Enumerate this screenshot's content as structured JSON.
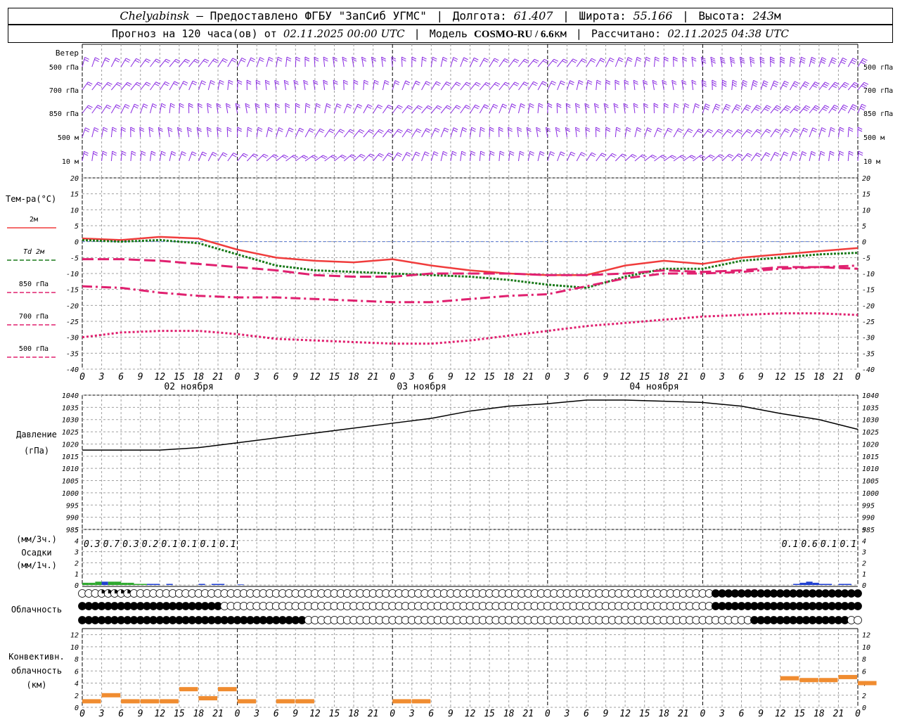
{
  "header": {
    "city": "Chelyabinsk",
    "dash": "–",
    "provider": "Предоставлено ФГБУ \"ЗапСиб УГМС\"",
    "lon_label": "Долгота:",
    "lon_value": "61.407",
    "lat_label": "Широта:",
    "lat_value": "55.166",
    "alt_label": "Высота:",
    "alt_value": "243",
    "alt_unit": "м",
    "forecast_label": "Прогноз на 120 часа(ов) от",
    "forecast_start": "02.11.2025 00:00 UTC",
    "model_label": "Модель",
    "model_name": "COSMO-RU / 6.6",
    "model_unit": "км",
    "calc_label": "Рассчитано:",
    "calc_time": "02.11.2025 04:38 UTC"
  },
  "labels": {
    "wind": "Ветер",
    "wind_levels": [
      "500 гПа",
      "700 гПа",
      "850 гПа",
      "500 м",
      "10  м"
    ],
    "temp": "Тем-ра(°C)",
    "temp_legend": [
      "2м",
      "Td  2м",
      "850 гПа",
      "700 гПа",
      "500 гПа"
    ],
    "pressure": "Давление",
    "pressure_unit": "(гПа)",
    "precip_unit3": "(мм/3ч.)",
    "precip": "Осадки",
    "precip_unit1": "(мм/1ч.)",
    "cloud": "Облачность",
    "conv1": "Конвективн.",
    "conv2": "облачность",
    "conv3": "(км)",
    "dates": [
      "02 ноября",
      "03 ноября",
      "04 ноября"
    ]
  },
  "colors": {
    "wind": "#8a2be2",
    "t2m": "#f03c3c",
    "td2m": "#1a7a1a",
    "t850": "#e0206f",
    "t700": "#e0206f",
    "t500": "#e0206f",
    "zero_line": "#5b7bd5",
    "precip_rain": "#2ea82e",
    "precip_snow": "#2040d0",
    "conv": "#f08c30",
    "grid": "#a0a0a0"
  },
  "chart_data": [
    {
      "type": "line",
      "panel": "temperature",
      "x_hours": [
        0,
        6,
        12,
        18,
        24,
        30,
        36,
        42,
        48,
        54,
        60,
        66,
        72,
        78,
        84,
        90,
        96,
        102,
        108,
        114,
        120
      ],
      "ylim": [
        -40,
        20
      ],
      "series": [
        {
          "name": "2м",
          "values": [
            1,
            0.5,
            1.5,
            1,
            -2.5,
            -5,
            -6,
            -6.5,
            -5.5,
            -7.5,
            -9,
            -10,
            -10.5,
            -10.5,
            -7.5,
            -6,
            -7,
            -5,
            -4,
            -3,
            -2
          ]
        },
        {
          "name": "Td  2м",
          "values": [
            0.5,
            0,
            0.5,
            -0.5,
            -4,
            -7.5,
            -9,
            -9.5,
            -10,
            -10.5,
            -11,
            -12,
            -13.5,
            -14.5,
            -11,
            -8.5,
            -8.5,
            -6,
            -5,
            -4,
            -3.5
          ]
        },
        {
          "name": "850 гПа",
          "values": [
            -5.5,
            -5.5,
            -6,
            -7,
            -8,
            -9,
            -10.5,
            -11,
            -11,
            -10,
            -10,
            -10,
            -10.5,
            -10.5,
            -10,
            -9,
            -9.5,
            -9,
            -8,
            -8,
            -8.5
          ]
        },
        {
          "name": "700 гПа",
          "values": [
            -14,
            -14.5,
            -16,
            -17,
            -17.5,
            -17.5,
            -18,
            -18.5,
            -19,
            -19,
            -18,
            -17,
            -16.5,
            -14,
            -11.5,
            -10,
            -10,
            -9.5,
            -8.5,
            -8,
            -7.5
          ]
        },
        {
          "name": "500 гПа",
          "values": [
            -30,
            -28.5,
            -28,
            -28,
            -29,
            -30.5,
            -31,
            -31.5,
            -32,
            -32,
            -31,
            -29.5,
            -28,
            -26.5,
            -25.5,
            -24.5,
            -23.5,
            -23,
            -22.5,
            -22.5,
            -23
          ]
        }
      ]
    },
    {
      "type": "line",
      "panel": "pressure",
      "x_hours": [
        0,
        6,
        12,
        18,
        24,
        30,
        36,
        42,
        48,
        54,
        60,
        66,
        72,
        78,
        84,
        90,
        96,
        102,
        108,
        114,
        120
      ],
      "ylim": [
        985,
        1040
      ],
      "series": [
        {
          "name": "Давление",
          "values": [
            1017.5,
            1017.5,
            1017.5,
            1018.5,
            1020.5,
            1022.5,
            1024.5,
            1026.5,
            1028.5,
            1030.5,
            1033.5,
            1035.5,
            1036.5,
            1038,
            1038,
            1037.5,
            1037,
            1035.5,
            1032.5,
            1030,
            1026
          ]
        }
      ]
    },
    {
      "type": "bar",
      "panel": "precipitation",
      "ylim": [
        0,
        5
      ],
      "x_hours_3h": [
        3,
        6,
        9,
        12,
        15,
        18,
        21,
        24,
        111,
        114,
        117,
        120
      ],
      "values_3h_labels": [
        "0.3",
        "0.7",
        "0.3",
        "0.2",
        "0.1",
        "0.1",
        "0.1",
        "0.1",
        "0.1",
        "0.6",
        "0.1",
        "0.1"
      ],
      "hourly": [
        {
          "h": 1,
          "v": 0.2,
          "kind": "rain"
        },
        {
          "h": 2,
          "v": 0.2,
          "kind": "rain"
        },
        {
          "h": 3,
          "v": 0.3,
          "kind": "rain"
        },
        {
          "h": 4,
          "v": 0.3,
          "kind": "snow"
        },
        {
          "h": 5,
          "v": 0.3,
          "kind": "rain"
        },
        {
          "h": 6,
          "v": 0.3,
          "kind": "rain"
        },
        {
          "h": 7,
          "v": 0.2,
          "kind": "rain"
        },
        {
          "h": 8,
          "v": 0.2,
          "kind": "rain"
        },
        {
          "h": 9,
          "v": 0.1,
          "kind": "rain"
        },
        {
          "h": 10,
          "v": 0.1,
          "kind": "rain"
        },
        {
          "h": 11,
          "v": 0.1,
          "kind": "snow"
        },
        {
          "h": 12,
          "v": 0.1,
          "kind": "snow"
        },
        {
          "h": 14,
          "v": 0.1,
          "kind": "snow"
        },
        {
          "h": 19,
          "v": 0.1,
          "kind": "snow"
        },
        {
          "h": 21,
          "v": 0.1,
          "kind": "snow"
        },
        {
          "h": 22,
          "v": 0.1,
          "kind": "snow"
        },
        {
          "h": 25,
          "v": 0.05,
          "kind": "snow"
        },
        {
          "h": 111,
          "v": 0.1,
          "kind": "snow"
        },
        {
          "h": 112,
          "v": 0.2,
          "kind": "snow"
        },
        {
          "h": 113,
          "v": 0.3,
          "kind": "snow"
        },
        {
          "h": 114,
          "v": 0.2,
          "kind": "snow"
        },
        {
          "h": 115,
          "v": 0.1,
          "kind": "snow"
        },
        {
          "h": 116,
          "v": 0.1,
          "kind": "snow"
        },
        {
          "h": 118,
          "v": 0.1,
          "kind": "snow"
        },
        {
          "h": 119,
          "v": 0.1,
          "kind": "snow"
        }
      ]
    },
    {
      "type": "bar",
      "panel": "convective_cloud",
      "ylim": [
        0,
        13
      ],
      "x_hours": [
        0,
        3,
        6,
        9,
        12,
        15,
        18,
        21,
        24,
        30,
        33,
        36,
        39,
        42,
        45,
        48,
        51,
        54,
        57,
        60,
        63,
        66,
        69,
        72,
        75,
        78,
        81,
        84,
        87,
        90,
        93,
        96,
        99,
        102,
        105,
        108,
        111,
        114,
        117,
        120
      ],
      "tops_km": [
        1,
        2,
        1,
        1,
        1,
        3,
        1.5,
        3,
        1,
        1,
        1,
        null,
        null,
        null,
        null,
        1,
        1,
        null,
        null,
        null,
        null,
        null,
        null,
        null,
        null,
        null,
        null,
        null,
        null,
        null,
        null,
        null,
        null,
        null,
        null,
        4.8,
        4.5,
        4.5,
        5,
        4
      ]
    }
  ]
}
